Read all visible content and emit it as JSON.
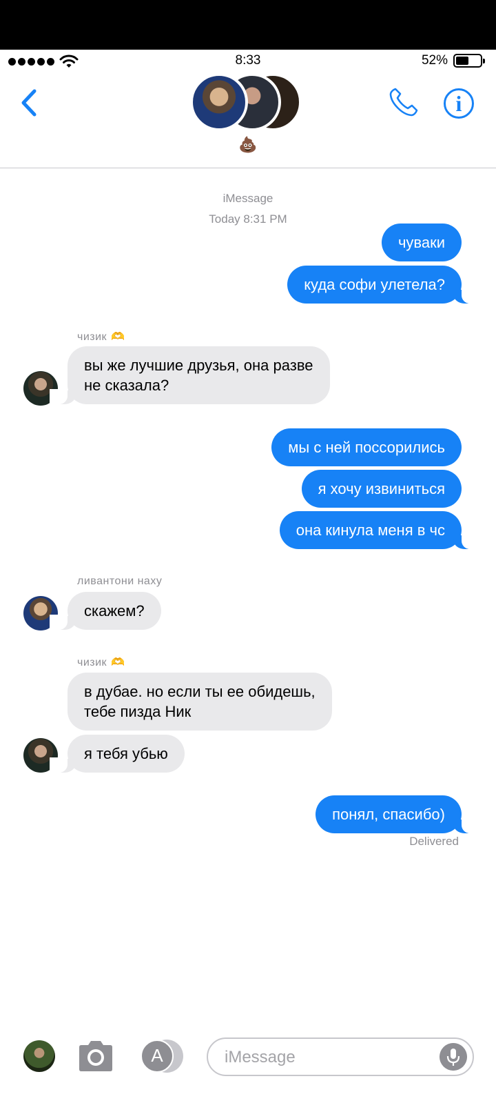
{
  "status_bar": {
    "time": "8:33",
    "battery_percent": "52%",
    "battery_level": 0.52,
    "signal_bars": 5
  },
  "header": {
    "group_name_emoji": "💩",
    "icons": {
      "back": "chevron-left-icon",
      "call": "phone-icon",
      "info": "info-icon"
    }
  },
  "conversation": {
    "service_label": "iMessage",
    "timestamp": "Today 8:31 PM",
    "messages": [
      {
        "direction": "outgoing",
        "text": "чуваки"
      },
      {
        "direction": "outgoing",
        "text": "куда софи улетела?"
      },
      {
        "direction": "incoming",
        "sender": "чизик",
        "sender_emoji": "🫶",
        "text": "вы же лучшие друзья, она разве\nне сказала?"
      },
      {
        "direction": "outgoing",
        "text": "мы с ней поссорились"
      },
      {
        "direction": "outgoing",
        "text": "я хочу извиниться"
      },
      {
        "direction": "outgoing",
        "text": "она кинула меня в чс"
      },
      {
        "direction": "incoming",
        "sender": "ливантони наху",
        "text": "скажем?"
      },
      {
        "direction": "incoming",
        "sender": "чизик",
        "sender_emoji": "🫶",
        "text": "в дубае. но если ты ее обидешь,\nтебе пизда Ник"
      },
      {
        "direction": "incoming",
        "text": "я тебя убью"
      },
      {
        "direction": "outgoing",
        "text": "понял, спасибо)"
      }
    ],
    "delivery_status": "Delivered"
  },
  "input_bar": {
    "placeholder": "iMessage",
    "icons": {
      "camera": "camera-icon",
      "apps": "app-store-icon",
      "mic": "microphone-icon"
    }
  },
  "colors": {
    "accent": "#1782f6",
    "incoming_bubble": "#e9e9eb",
    "secondary_text": "#8e8e93"
  }
}
